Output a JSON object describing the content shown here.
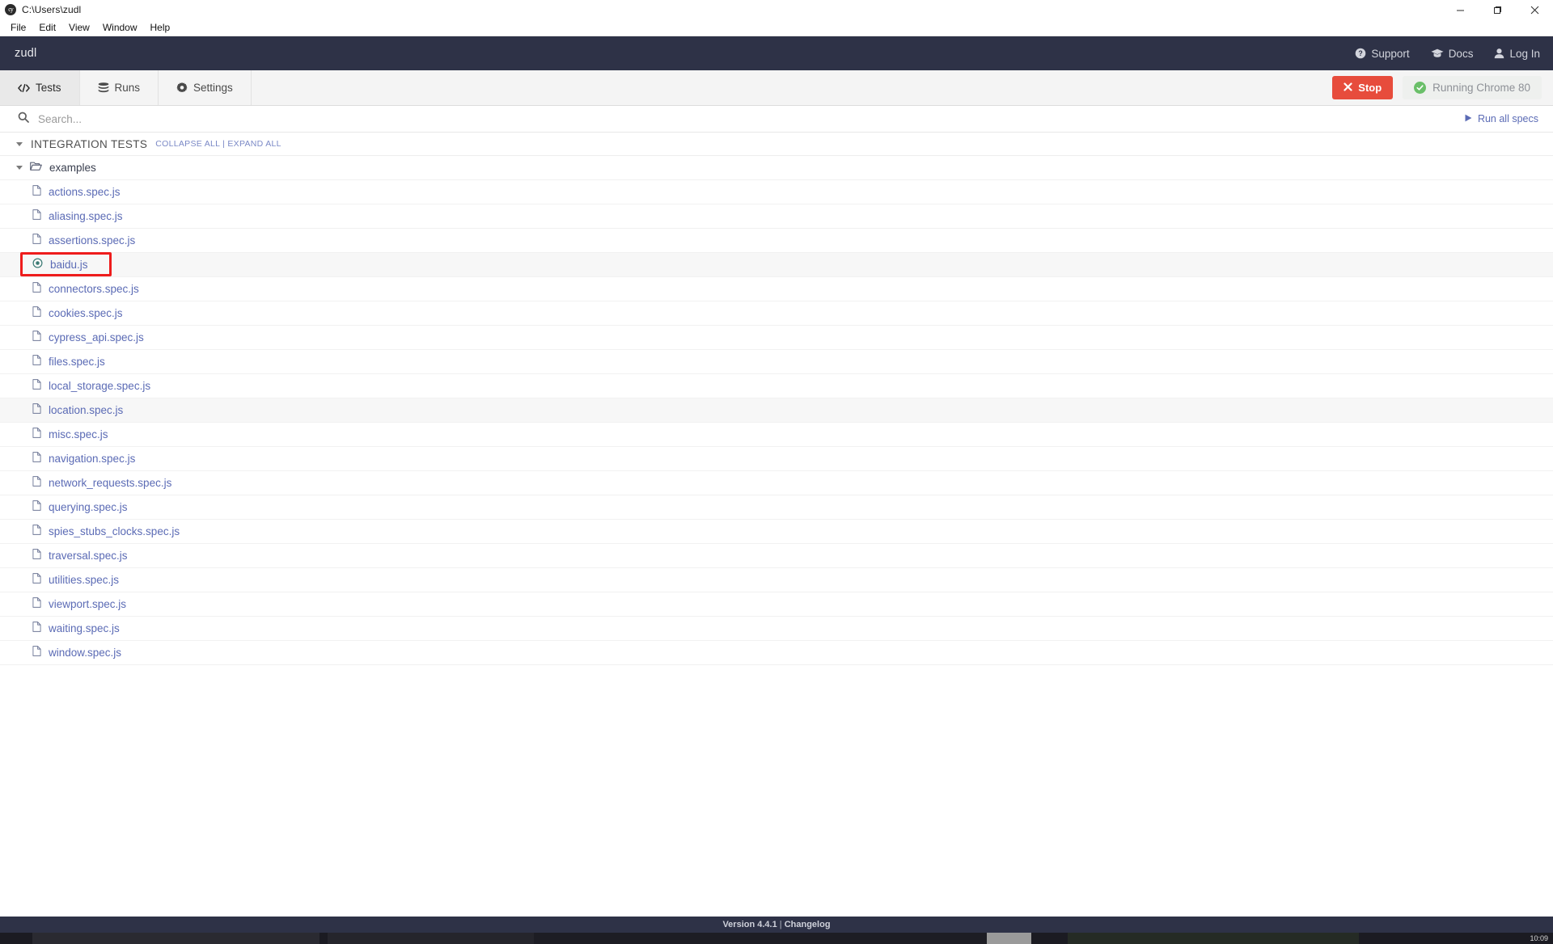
{
  "window": {
    "title": "C:\\Users\\zudl",
    "app_icon": "cypress-icon",
    "controls": {
      "minimize": "minimize-icon",
      "maximize": "maximize-icon",
      "close": "close-icon"
    }
  },
  "menubar": {
    "items": [
      "File",
      "Edit",
      "View",
      "Window",
      "Help"
    ]
  },
  "header": {
    "project_name": "zudl",
    "links": [
      {
        "label": "Support",
        "icon": "question-circle-icon"
      },
      {
        "label": "Docs",
        "icon": "graduation-cap-icon"
      },
      {
        "label": "Log In",
        "icon": "user-icon"
      }
    ]
  },
  "tabbar": {
    "tabs": [
      {
        "label": "Tests",
        "icon": "code-icon",
        "active": true
      },
      {
        "label": "Runs",
        "icon": "server-icon",
        "active": false
      },
      {
        "label": "Settings",
        "icon": "gear-icon",
        "active": false
      }
    ],
    "stop_button": {
      "label": "Stop",
      "icon": "close-x-icon",
      "color": "#e74c3c"
    },
    "browser_status": {
      "label": "Running Chrome 80",
      "icon": "check-circle-icon",
      "color": "#6abf69"
    }
  },
  "search": {
    "placeholder": "Search...",
    "value": "",
    "icon": "search-icon",
    "run_all": {
      "label": "Run all specs",
      "icon": "play-icon"
    }
  },
  "specs": {
    "group_title": "INTEGRATION TESTS",
    "collapse_all": "COLLAPSE ALL",
    "expand_all": "EXPAND ALL",
    "links_text": "COLLAPSE ALL | EXPAND ALL",
    "folder": {
      "name": "examples",
      "icon": "folder-open-icon"
    },
    "files": [
      {
        "name": "actions.spec.js",
        "icon": "file-icon",
        "striped": false,
        "highlighted": false
      },
      {
        "name": "aliasing.spec.js",
        "icon": "file-icon",
        "striped": false,
        "highlighted": false
      },
      {
        "name": "assertions.spec.js",
        "icon": "file-icon",
        "striped": false,
        "highlighted": false
      },
      {
        "name": "baidu.js",
        "icon": "dot-circle-icon",
        "striped": true,
        "highlighted": true
      },
      {
        "name": "connectors.spec.js",
        "icon": "file-icon",
        "striped": false,
        "highlighted": false
      },
      {
        "name": "cookies.spec.js",
        "icon": "file-icon",
        "striped": false,
        "highlighted": false
      },
      {
        "name": "cypress_api.spec.js",
        "icon": "file-icon",
        "striped": false,
        "highlighted": false
      },
      {
        "name": "files.spec.js",
        "icon": "file-icon",
        "striped": false,
        "highlighted": false
      },
      {
        "name": "local_storage.spec.js",
        "icon": "file-icon",
        "striped": false,
        "highlighted": false
      },
      {
        "name": "location.spec.js",
        "icon": "file-icon",
        "striped": true,
        "highlighted": false
      },
      {
        "name": "misc.spec.js",
        "icon": "file-icon",
        "striped": false,
        "highlighted": false
      },
      {
        "name": "navigation.spec.js",
        "icon": "file-icon",
        "striped": false,
        "highlighted": false
      },
      {
        "name": "network_requests.spec.js",
        "icon": "file-icon",
        "striped": false,
        "highlighted": false
      },
      {
        "name": "querying.spec.js",
        "icon": "file-icon",
        "striped": false,
        "highlighted": false
      },
      {
        "name": "spies_stubs_clocks.spec.js",
        "icon": "file-icon",
        "striped": false,
        "highlighted": false
      },
      {
        "name": "traversal.spec.js",
        "icon": "file-icon",
        "striped": false,
        "highlighted": false
      },
      {
        "name": "utilities.spec.js",
        "icon": "file-icon",
        "striped": false,
        "highlighted": false
      },
      {
        "name": "viewport.spec.js",
        "icon": "file-icon",
        "striped": false,
        "highlighted": false
      },
      {
        "name": "waiting.spec.js",
        "icon": "file-icon",
        "striped": false,
        "highlighted": false
      },
      {
        "name": "window.spec.js",
        "icon": "file-icon",
        "striped": false,
        "highlighted": false
      }
    ]
  },
  "footer": {
    "version_label": "Version 4.4.1",
    "separator": " | ",
    "changelog_label": "Changelog"
  },
  "taskbar": {
    "clock": "10:09"
  },
  "colors": {
    "header_bg": "#2e3247",
    "link_blue": "#5b6bb5",
    "stop_red": "#e74c3c",
    "status_green": "#6abf69",
    "highlight_red": "#ee1c1c"
  }
}
